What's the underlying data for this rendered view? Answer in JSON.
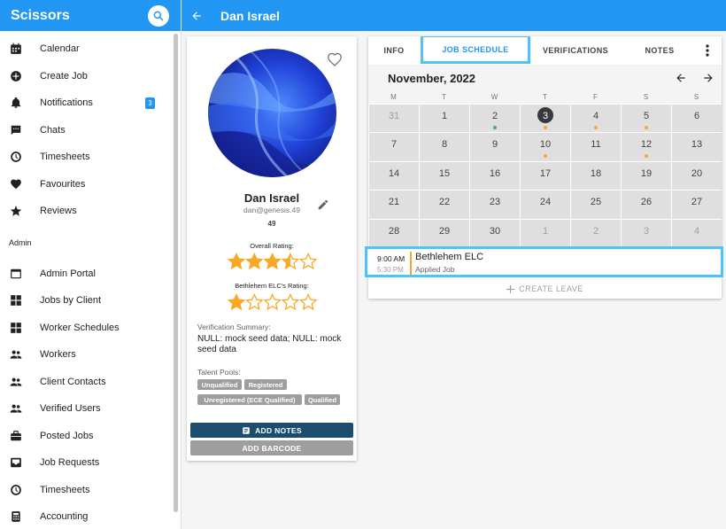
{
  "app": {
    "title": "Scissors"
  },
  "header": {
    "title": "Dan Israel"
  },
  "sidebar": {
    "items": [
      {
        "label": "Calendar",
        "icon": "calendar-icon"
      },
      {
        "label": "Create Job",
        "icon": "add-circle-icon"
      },
      {
        "label": "Notifications",
        "icon": "bell-icon",
        "badge": "3"
      },
      {
        "label": "Chats",
        "icon": "chat-icon"
      },
      {
        "label": "Timesheets",
        "icon": "clock-icon"
      },
      {
        "label": "Favourites",
        "icon": "heart-icon"
      },
      {
        "label": "Reviews",
        "icon": "star-icon"
      }
    ],
    "section": "Admin",
    "admin_items": [
      {
        "label": "Admin Portal",
        "icon": "window-icon"
      },
      {
        "label": "Jobs by Client",
        "icon": "grid-icon"
      },
      {
        "label": "Worker Schedules",
        "icon": "grid-icon"
      },
      {
        "label": "Workers",
        "icon": "people-icon"
      },
      {
        "label": "Client Contacts",
        "icon": "people-icon"
      },
      {
        "label": "Verified Users",
        "icon": "people-icon"
      },
      {
        "label": "Posted Jobs",
        "icon": "briefcase-icon"
      },
      {
        "label": "Job Requests",
        "icon": "inbox-icon"
      },
      {
        "label": "Timesheets",
        "icon": "clock-icon"
      },
      {
        "label": "Accounting",
        "icon": "calculator-icon"
      }
    ]
  },
  "profile": {
    "name": "Dan Israel",
    "email": "dan@genesis.49",
    "number": "49",
    "overall_label": "Overall Rating:",
    "overall_rating": 3.5,
    "client_label": "Bethlehem ELC's Rating:",
    "client_rating": 1,
    "verification_label": "Verification Summary:",
    "verification_text": "NULL: mock seed data; NULL: mock seed data",
    "talent_label": "Talent Pools:",
    "talent_pools": [
      "Unqualified",
      "Registered",
      "Unregistered (ECE Qualified)",
      "Qualified"
    ],
    "add_notes": "ADD NOTES",
    "add_barcode": "ADD BARCODE"
  },
  "tabs": [
    "INFO",
    "JOB SCHEDULE",
    "VERIFICATIONS",
    "NOTES"
  ],
  "active_tab": "JOB SCHEDULE",
  "calendar": {
    "month": "November, 2022",
    "weekdays": [
      "M",
      "T",
      "W",
      "T",
      "F",
      "S",
      "S"
    ],
    "weeks": [
      [
        "31",
        "1",
        "2",
        "3",
        "4",
        "5",
        "6"
      ],
      [
        "7",
        "8",
        "9",
        "10",
        "11",
        "12",
        "13"
      ],
      [
        "14",
        "15",
        "16",
        "17",
        "18",
        "19",
        "20"
      ],
      [
        "21",
        "22",
        "23",
        "24",
        "25",
        "26",
        "27"
      ],
      [
        "28",
        "29",
        "30",
        "1",
        "2",
        "3",
        "4"
      ]
    ],
    "today": "3",
    "dots": {
      "2": "#4caf50",
      "3": "#f9a825",
      "4": "#f9a825",
      "5": "#f9a825",
      "10": "#f9a825",
      "12": "#f9a825"
    }
  },
  "event": {
    "start": "9:00 AM",
    "end": "5:30 PM",
    "title": "Bethlehem ELC",
    "subtitle": "Applied Job"
  },
  "create_leave": "CREATE LEAVE",
  "colors": {
    "primary": "#2196f3",
    "highlight": "#4fc3f7",
    "accent": "#f9a825",
    "notes_button": "#1a4d6e"
  }
}
